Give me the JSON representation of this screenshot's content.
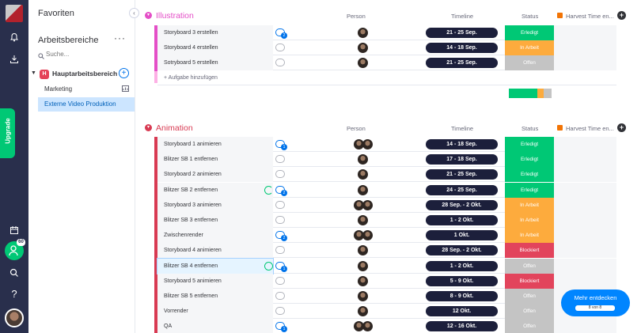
{
  "sidebar": {
    "title": "Favoriten",
    "collapse_icon": "‹",
    "workspaces_title": "Arbeitsbereiche",
    "more_icon": "···",
    "search_placeholder": "Suche...",
    "workspace": {
      "badge": "H",
      "name": "Hauptarbeitsbereich"
    },
    "items": [
      {
        "label": "Marketing"
      },
      {
        "label": "Externe Video Produktion"
      }
    ]
  },
  "leftbar": {
    "upgrade_label": "Upgrade",
    "invite_badge": "60",
    "help_label": "?"
  },
  "columns": {
    "person": "Person",
    "timeline": "Timeline",
    "status": "Status",
    "harvest": "Harvest Time en..."
  },
  "colors": {
    "done": "#00c875",
    "working": "#fdab3d",
    "stuck": "#e2445c",
    "open": "#c4c4c4",
    "illustration": "#e44ec7",
    "animation": "#d83a52"
  },
  "groups": [
    {
      "title": "Illustration",
      "rows": [
        {
          "name": "Storyboard 3 erstellen",
          "updates": "2",
          "avatars": 1,
          "timeline": "21 - 25 Sep.",
          "status": "Erledigt",
          "status_key": "done"
        },
        {
          "name": "Storyboard 4 erstellen",
          "updates": "",
          "avatars": 1,
          "timeline": "14 - 18 Sep.",
          "status": "In Arbeit",
          "status_key": "working"
        },
        {
          "name": "Sotryboard 5 erstellen",
          "updates": "",
          "avatars": 1,
          "timeline": "21 - 25 Sep.",
          "status": "Offen",
          "status_key": "open"
        }
      ],
      "add_label": "+ Aufgabe hinzufügen",
      "summary": [
        {
          "key": "done",
          "fraction": 0.67
        },
        {
          "key": "working",
          "fraction": 0.15
        },
        {
          "key": "open",
          "fraction": 0.18
        }
      ]
    },
    {
      "title": "Animation",
      "rows": [
        {
          "name": "Storyboard 1 animieren",
          "updates": "1",
          "avatars": 2,
          "timeline": "14 - 18 Sep.",
          "status": "Erledigt",
          "status_key": "done"
        },
        {
          "name": "Blitzer SB 1 entfernen",
          "updates": "",
          "avatars": 1,
          "timeline": "17 - 18 Sep.",
          "status": "Erledigt",
          "status_key": "done"
        },
        {
          "name": "Storyboard 2 animieren",
          "updates": "",
          "avatars": 1,
          "timeline": "21 - 25 Sep.",
          "status": "Erledigt",
          "status_key": "done"
        },
        {
          "name": "Blitzer SB 2 entfernen",
          "updates": "2",
          "avatars": 1,
          "timeline": "24 - 25 Sep.",
          "status": "Erledigt",
          "status_key": "done",
          "progress": true
        },
        {
          "name": "Storyboard 3 animieren",
          "updates": "",
          "avatars": 2,
          "timeline": "28 Sep. - 2 Okt.",
          "status": "In Arbeit",
          "status_key": "working"
        },
        {
          "name": "Blitzer SB 3 entfernen",
          "updates": "",
          "avatars": 1,
          "timeline": "1 - 2 Okt.",
          "status": "In Arbeit",
          "status_key": "working"
        },
        {
          "name": "Zwischenrender",
          "updates": "2",
          "avatars": 2,
          "timeline": "1 Okt.",
          "status": "In Arbeit",
          "status_key": "working"
        },
        {
          "name": "Storyboard 4 animieren",
          "updates": "",
          "avatars": 1,
          "timeline": "28 Sep. - 2 Okt.",
          "status": "Blockiert",
          "status_key": "stuck"
        },
        {
          "name": "Blitzer SB 4 entfernen",
          "updates": "1",
          "avatars": 1,
          "timeline": "1 - 2 Okt.",
          "status": "Offen",
          "status_key": "open",
          "checked": true
        },
        {
          "name": "Storyboard 5 animieren",
          "updates": "",
          "avatars": 1,
          "timeline": "5 - 9 Okt.",
          "status": "Blockiert",
          "status_key": "stuck"
        },
        {
          "name": "Blitzer SB 5 entfernen",
          "updates": "",
          "avatars": 1,
          "timeline": "8 - 9 Okt.",
          "status": "Offen",
          "status_key": "open"
        },
        {
          "name": "Vorrender",
          "updates": "",
          "avatars": 1,
          "timeline": "12 Okt.",
          "status": "Offen",
          "status_key": "open"
        },
        {
          "name": "QA",
          "updates": "1",
          "avatars": 2,
          "timeline": "12 - 16 Okt.",
          "status": "Offen",
          "status_key": "open"
        }
      ]
    }
  ],
  "discover": {
    "label": "Mehr entdecken",
    "progress": "8 von 8"
  }
}
